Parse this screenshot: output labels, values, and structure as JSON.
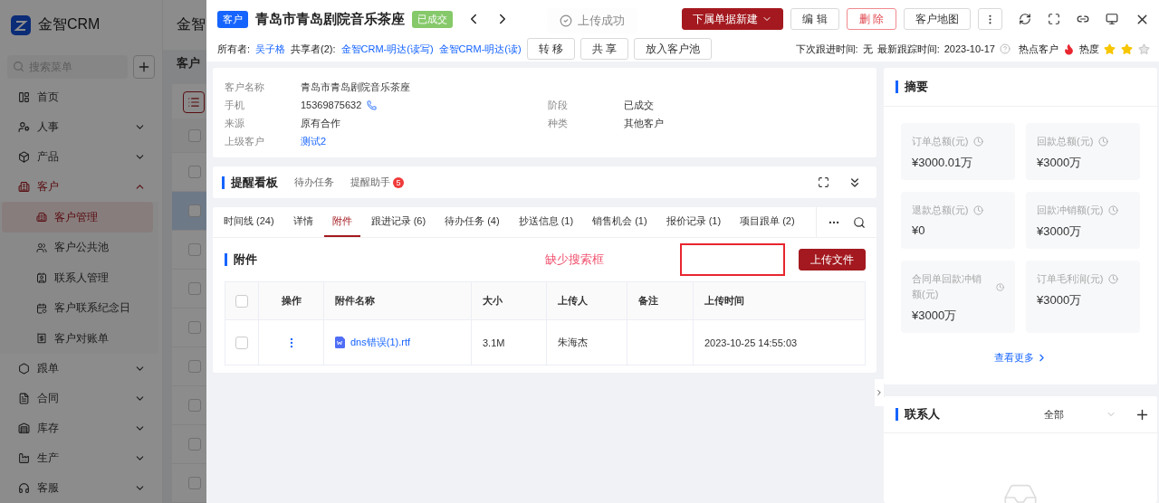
{
  "background_page": {
    "brand": "金智CRM",
    "search": {
      "placeholder": "搜索菜单"
    },
    "menu": [
      {
        "label": "首页",
        "kind": "link",
        "selected": false
      },
      {
        "label": "人事",
        "kind": "group",
        "selected": false,
        "expanded": false
      },
      {
        "label": "产品",
        "kind": "group",
        "selected": false,
        "expanded": false
      },
      {
        "label": "客户",
        "kind": "group",
        "selected": true,
        "expanded": true,
        "children": [
          {
            "label": "客户管理",
            "selected": true
          },
          {
            "label": "客户公共池",
            "selected": false
          },
          {
            "label": "联系人管理",
            "selected": false
          },
          {
            "label": "客户联系纪念日",
            "selected": false
          },
          {
            "label": "客户对账单",
            "selected": false
          }
        ]
      },
      {
        "label": "跟单",
        "kind": "group",
        "selected": false,
        "expanded": false
      },
      {
        "label": "合同",
        "kind": "group",
        "selected": false,
        "expanded": false
      },
      {
        "label": "库存",
        "kind": "group",
        "selected": false,
        "expanded": false
      },
      {
        "label": "生产",
        "kind": "group",
        "selected": false,
        "expanded": false
      },
      {
        "label": "客服",
        "kind": "group",
        "selected": false,
        "expanded": false
      }
    ],
    "header_title": "金智",
    "page_title": "客户",
    "header_checked": false,
    "rows": [
      {
        "checked": false,
        "highlighted": false
      },
      {
        "checked": false,
        "highlighted": true
      },
      {
        "checked": false,
        "highlighted": false
      },
      {
        "checked": false,
        "highlighted": false
      },
      {
        "checked": false,
        "highlighted": false
      },
      {
        "checked": false,
        "highlighted": false
      },
      {
        "checked": false,
        "highlighted": false
      },
      {
        "checked": false,
        "highlighted": false
      },
      {
        "checked": false,
        "highlighted": false
      }
    ]
  },
  "drawer": {
    "header": {
      "type_badge": "客户",
      "title": "青岛市青岛剧院音乐茶座",
      "status_tag": "已成交",
      "toast": "上传成功",
      "actions": [
        {
          "kind": "primary",
          "label": "下属单据新建"
        },
        {
          "kind": "default",
          "label": "编 辑"
        },
        {
          "kind": "danger",
          "label": "删 除"
        },
        {
          "kind": "default",
          "label": "客户地图"
        },
        {
          "kind": "more"
        }
      ],
      "owner_label": "所有者:",
      "owner": "吴子格",
      "sharers_label": "共享者(2):",
      "sharers": [
        "金智CRM-明达(读写)",
        "金智CRM-明达(读)"
      ],
      "owner_actions": [
        "转 移",
        "共 享",
        "放入客户池"
      ],
      "next_follow_label": "下次跟进时间:",
      "next_follow": "无",
      "last_track_label": "最新跟踪时间:",
      "last_track": "2023-10-17",
      "hot_label": "热点客户",
      "heat_label": "热度",
      "stars": 2
    },
    "info": [
      {
        "label": "客户名称",
        "value": "青岛市青岛剧院音乐茶座",
        "kind": "wide"
      },
      {
        "label": "手机",
        "value": "15369875632",
        "kind": "phone"
      },
      {
        "label": "阶段",
        "value": "已成交",
        "kind": "text"
      },
      {
        "label": "来源",
        "value": "原有合作",
        "kind": "text"
      },
      {
        "label": "种类",
        "value": "其他客户",
        "kind": "text"
      },
      {
        "label": "上级客户",
        "value": "测试2",
        "kind": "link"
      }
    ],
    "reminder_board": {
      "title": "提醒看板",
      "tabs": [
        {
          "label": "待办任务",
          "selected": false
        },
        {
          "label": "提醒助手",
          "badge": "5",
          "selected": false
        }
      ]
    },
    "tabs": [
      {
        "label": "时间线 (24)",
        "selected": false
      },
      {
        "label": "详情",
        "selected": false
      },
      {
        "label": "附件",
        "selected": true
      },
      {
        "label": "跟进记录 (6)",
        "selected": false
      },
      {
        "label": "待办任务 (4)",
        "selected": false
      },
      {
        "label": "抄送信息 (1)",
        "selected": false
      },
      {
        "label": "销售机会 (1)",
        "selected": false
      },
      {
        "label": "报价记录 (1)",
        "selected": false
      },
      {
        "label": "项目跟单 (2)",
        "selected": false
      }
    ],
    "attachments": {
      "title": "附件",
      "annotation": "缺少搜索框",
      "upload_button": "上传文件",
      "header_checked": false,
      "columns": [
        "操作",
        "附件名称",
        "大小",
        "上传人",
        "备注",
        "上传时间"
      ],
      "rows": [
        {
          "checked": false,
          "file": "dns错误(1).rtf",
          "size": "3.1M",
          "uploader": "朱海杰",
          "time": "2023-10-25 14:55:03"
        }
      ]
    },
    "summary": {
      "title": "摘要",
      "metrics": [
        {
          "label": "订单总额(元)",
          "value": "¥3000.01万"
        },
        {
          "label": "回款总额(元)",
          "value": "¥3000万"
        },
        {
          "label": "退款总额(元)",
          "value": "¥0"
        },
        {
          "label": "回款冲销额(元)",
          "value": "¥3000万"
        },
        {
          "label": "合同单回款冲销额(元)",
          "value": "¥3000万"
        },
        {
          "label": "订单毛利润(元)",
          "value": "¥3000万"
        }
      ],
      "more_link": "查看更多"
    },
    "contacts": {
      "title": "联系人",
      "filter": "全部"
    }
  }
}
